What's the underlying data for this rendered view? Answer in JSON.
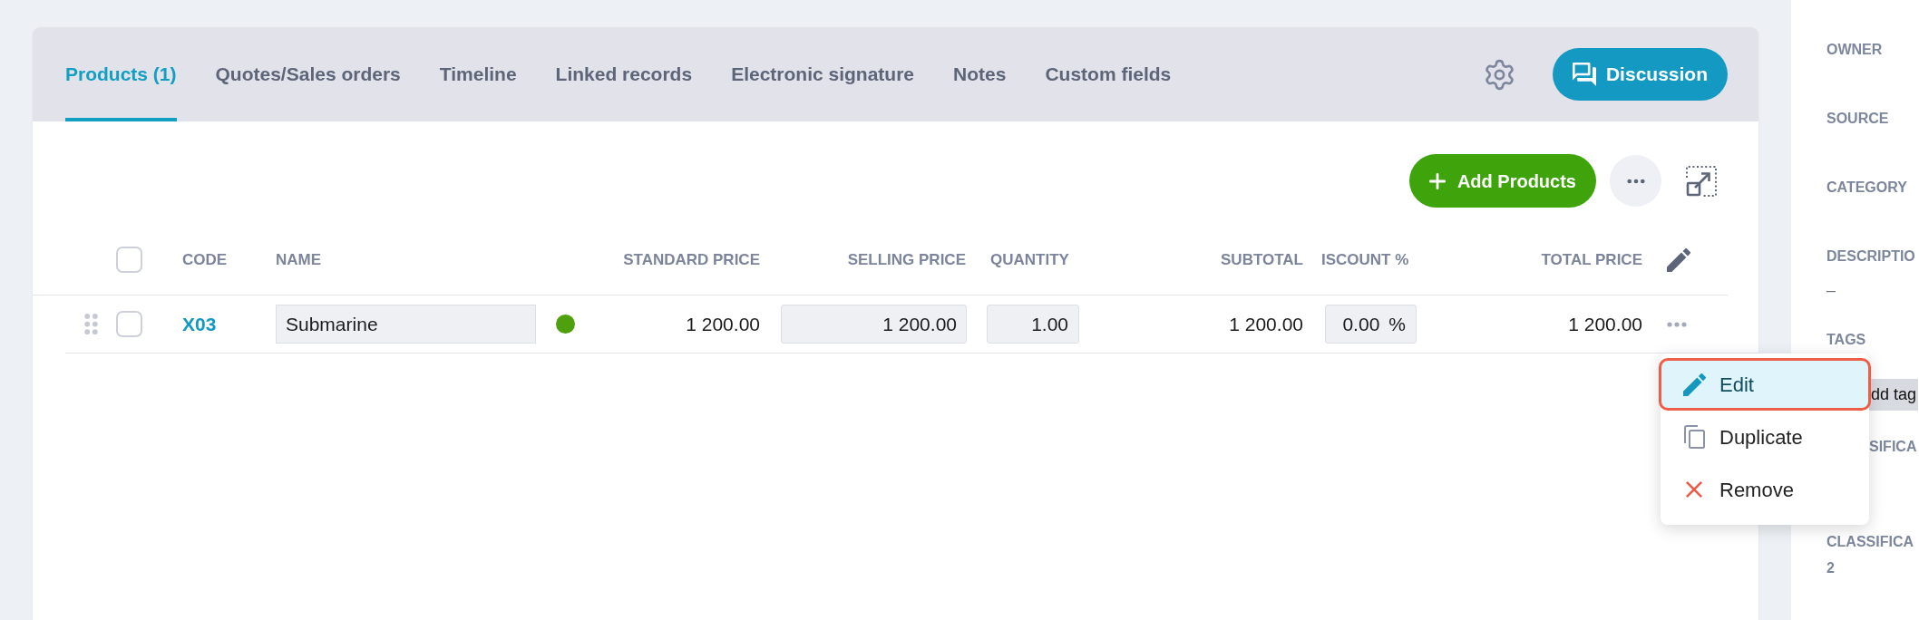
{
  "tabs": [
    {
      "label": "Products (1)",
      "selected": true
    },
    {
      "label": "Quotes/Sales orders",
      "selected": false
    },
    {
      "label": "Timeline",
      "selected": false
    },
    {
      "label": "Linked records",
      "selected": false
    },
    {
      "label": "Electronic signature",
      "selected": false
    },
    {
      "label": "Notes",
      "selected": false
    },
    {
      "label": "Custom fields",
      "selected": false
    }
  ],
  "discussion_button": {
    "label": "Discussion"
  },
  "toolbar": {
    "add_button": {
      "label": "Add Products"
    }
  },
  "table": {
    "header_checkbox": {
      "checked": false
    },
    "columns": [
      "CODE",
      "NAME",
      "STANDARD PRICE",
      "SELLING PRICE",
      "QUANTITY",
      "SUBTOTAL",
      "ISCOUNT %",
      "TOTAL PRICE"
    ],
    "rows": [
      {
        "checked": false,
        "code": "X03",
        "name": "Submarine",
        "color": "#4fa00d",
        "standard_price": "1 200.00",
        "selling_price": "1 200.00",
        "quantity": "1.00",
        "subtotal": "1 200.00",
        "discount": "0.00",
        "discount_unit": "%",
        "total_price": "1 200.00"
      }
    ]
  },
  "row_menu": {
    "items": [
      {
        "kind": "edit",
        "label": "Edit",
        "selected": true
      },
      {
        "kind": "duplicate",
        "label": "Duplicate",
        "selected": false
      },
      {
        "kind": "remove",
        "label": "Remove",
        "selected": false
      }
    ]
  },
  "sidebar": {
    "fields": [
      {
        "label": "OWNER",
        "covered": false
      },
      {
        "label": "SOURCE",
        "covered": false
      },
      {
        "label": "CATEGORY",
        "covered": false
      },
      {
        "label": "DESCRIPTIO",
        "value": "–",
        "covered": false
      },
      {
        "label": "TAGS",
        "tag": {
          "label": "dd tag",
          "covered": true
        },
        "covered": false
      },
      {
        "label": "SIFICA",
        "covered": true
      },
      {
        "label": "CLASSIFICA 2",
        "covered": false
      }
    ]
  }
}
